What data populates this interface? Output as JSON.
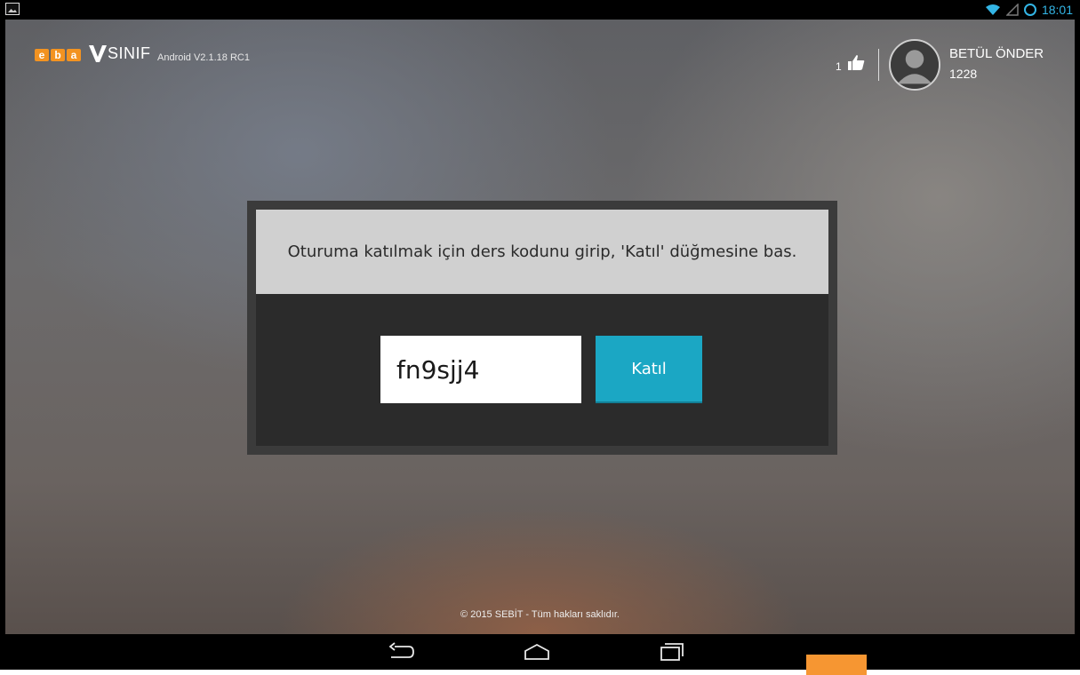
{
  "status_bar": {
    "time": "18:01",
    "accent": "#33b5e5",
    "icons": [
      "gallery-icon",
      "wifi-icon",
      "signal-icon",
      "battery-icon"
    ]
  },
  "app": {
    "logo_eba": [
      "e",
      "b",
      "a"
    ],
    "logo_sinif": "SINIF",
    "version": "Android V2.1.18 RC1",
    "likes": "1",
    "user": {
      "name": "BETÜL ÖNDER",
      "id": "1228"
    },
    "brand_color": "#f39321"
  },
  "dialog": {
    "message": "Oturuma katılmak için ders kodunu girip, 'Katıl' düğmesine bas.",
    "code_value": "fn9sjj4",
    "join_label": "Katıl",
    "button_color": "#1ba7c4"
  },
  "footer": {
    "copyright": "© 2015 SEBİT - Tüm hakları saklıdır."
  },
  "navbar": {
    "buttons": [
      "back-icon",
      "home-icon",
      "recent-apps-icon"
    ]
  }
}
